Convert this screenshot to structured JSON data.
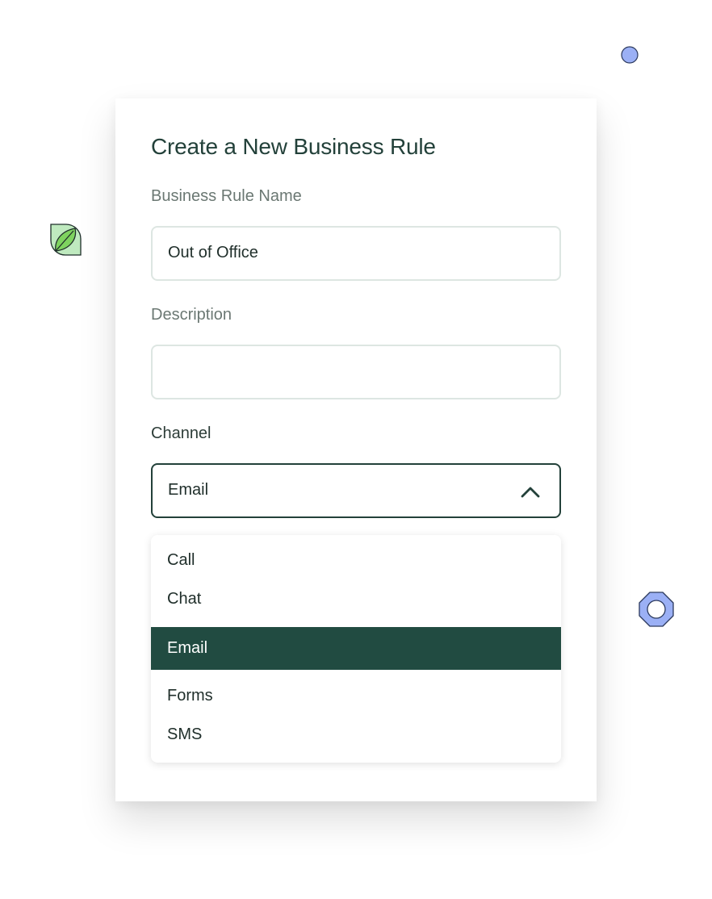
{
  "dialog": {
    "title": "Create a New Business Rule"
  },
  "form": {
    "name_label": "Business Rule Name",
    "name_value": "Out of Office",
    "description_label": "Description",
    "description_value": "",
    "channel_label": "Channel",
    "channel_value": "Email"
  },
  "dropdown": {
    "options": [
      {
        "label": "Call",
        "selected": false
      },
      {
        "label": "Chat",
        "selected": false
      },
      {
        "label": "Email",
        "selected": true
      },
      {
        "label": "Forms",
        "selected": false
      },
      {
        "label": "SMS",
        "selected": false
      }
    ]
  },
  "icons": {
    "chevron": "chevron-up-icon",
    "leaf": "leaf-icon",
    "dot": "circle-dot-icon",
    "ring": "ring-icon"
  },
  "colors": {
    "accent": "#214b41",
    "title": "#23413a",
    "border": "#dde6e2",
    "leaf_fill": "#bfeabf",
    "leaf_inner": "#7ed35f",
    "blue_deco": "#9bb0f5"
  }
}
